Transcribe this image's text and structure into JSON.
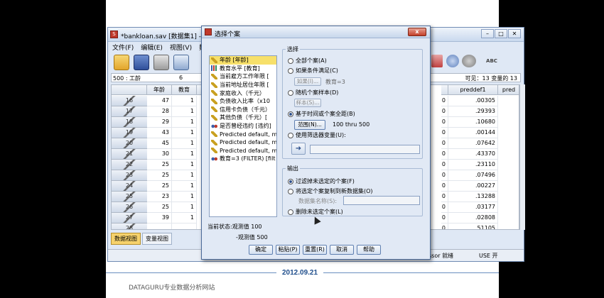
{
  "slide": {
    "date": "2012.09.21",
    "footer": "DATAGURU专业数据分析网站"
  },
  "main_window": {
    "title": "*bankloan.sav [数据集1] - IBM",
    "menu": [
      "文件(F)",
      "编辑(E)",
      "视图(V)",
      "数据"
    ],
    "cell_ref": "500 : 工龄",
    "cell_value": "6",
    "visible_vars": "可见：13 变量的 13",
    "toolbar_right_label": "ABC",
    "columns": {
      "left": [
        "年龄",
        "教育"
      ],
      "right": [
        "preddef1",
        "pred"
      ]
    },
    "rows": [
      {
        "row": "16",
        "age": "47",
        "edu": "1",
        "right": "0",
        "pred": ".00305"
      },
      {
        "row": "17",
        "age": "28",
        "edu": "1",
        "right": "0",
        "pred": ".29393"
      },
      {
        "row": "18",
        "age": "29",
        "edu": "1",
        "right": "0",
        "pred": ".10680"
      },
      {
        "row": "19",
        "age": "43",
        "edu": "1",
        "right": "0",
        "pred": ".00144"
      },
      {
        "row": "20",
        "age": "45",
        "edu": "1",
        "right": "0",
        "pred": ".07642"
      },
      {
        "row": "21",
        "age": "30",
        "edu": "1",
        "right": "0",
        "pred": ".43370"
      },
      {
        "row": "22",
        "age": "25",
        "edu": "1",
        "right": "0",
        "pred": ".23110"
      },
      {
        "row": "23",
        "age": "25",
        "edu": "1",
        "right": "0",
        "pred": ".07496"
      },
      {
        "row": "24",
        "age": "25",
        "edu": "1",
        "right": "0",
        "pred": ".00227"
      },
      {
        "row": "25",
        "age": "23",
        "edu": "1",
        "right": "0",
        "pred": ".13288"
      },
      {
        "row": "26",
        "age": "25",
        "edu": "1",
        "right": "0",
        "pred": ".03177"
      },
      {
        "row": "27",
        "age": "39",
        "edu": "1",
        "right": "0",
        "pred": ".02808"
      },
      {
        "row": "28",
        "age": "",
        "edu": "",
        "right": "0",
        "pred": ".51105"
      }
    ],
    "tabs": [
      "数据视图",
      "变量视图"
    ],
    "status": {
      "processor": "ssor 就绪",
      "unicode": "USE 开"
    }
  },
  "dialog": {
    "title": "选择个案",
    "close_label": "x",
    "variables": [
      {
        "label": "年龄 [年龄]",
        "icon": "scale-ruler-icon"
      },
      {
        "label": "教育水平 [教育]",
        "icon": "ordinal-bars-icon"
      },
      {
        "label": "当前雇方工作年限 [",
        "icon": "scale-ruler-icon"
      },
      {
        "label": "当前地址居住年限 [",
        "icon": "scale-ruler-icon"
      },
      {
        "label": "家庭收入（千元）",
        "icon": "scale-ruler-icon"
      },
      {
        "label": "负债收入比率（x10",
        "icon": "scale-ruler-icon"
      },
      {
        "label": "信用卡负债（千元）",
        "icon": "scale-ruler-icon"
      },
      {
        "label": "其他负债（千元）[",
        "icon": "scale-ruler-icon"
      },
      {
        "label": "是否曾经违约 [违约]",
        "icon": "nominal-icon"
      },
      {
        "label": "Predicted default, m",
        "icon": "scale-ruler-icon"
      },
      {
        "label": "Predicted default, m",
        "icon": "scale-ruler-icon"
      },
      {
        "label": "Predicted default, m",
        "icon": "scale-ruler-icon"
      },
      {
        "label": "教育=3 (FILTER) [filt",
        "icon": "nominal-icon"
      }
    ],
    "select_group": {
      "legend": "选择",
      "all_cases": "全部个案(A)",
      "if_condition": "如果条件满足(C)",
      "if_button": "如果(I)...",
      "if_value": "教育=3",
      "random": "随机个案样本(D)",
      "sample_button": "样本(S)...",
      "range_option": "基于时间或个案全距(B)",
      "range_button": "范围(N)...",
      "range_value": "100 thru 500",
      "filter_var": "使用筛选器变量(U):",
      "arrow": "➜"
    },
    "output_group": {
      "legend": "输出",
      "filter_out": "过滤掉未选定的个案(F)",
      "copy": "将选定个案复制到新数据集(O)",
      "dataset_label": "数据集名称(S):",
      "delete": "删除未选定个案(L)"
    },
    "current_status": "当前状态:观测值 100",
    "current_status_2": "-观测值 500",
    "buttons": [
      "确定",
      "粘贴(P)",
      "重置(R)",
      "取消",
      "帮助"
    ]
  }
}
